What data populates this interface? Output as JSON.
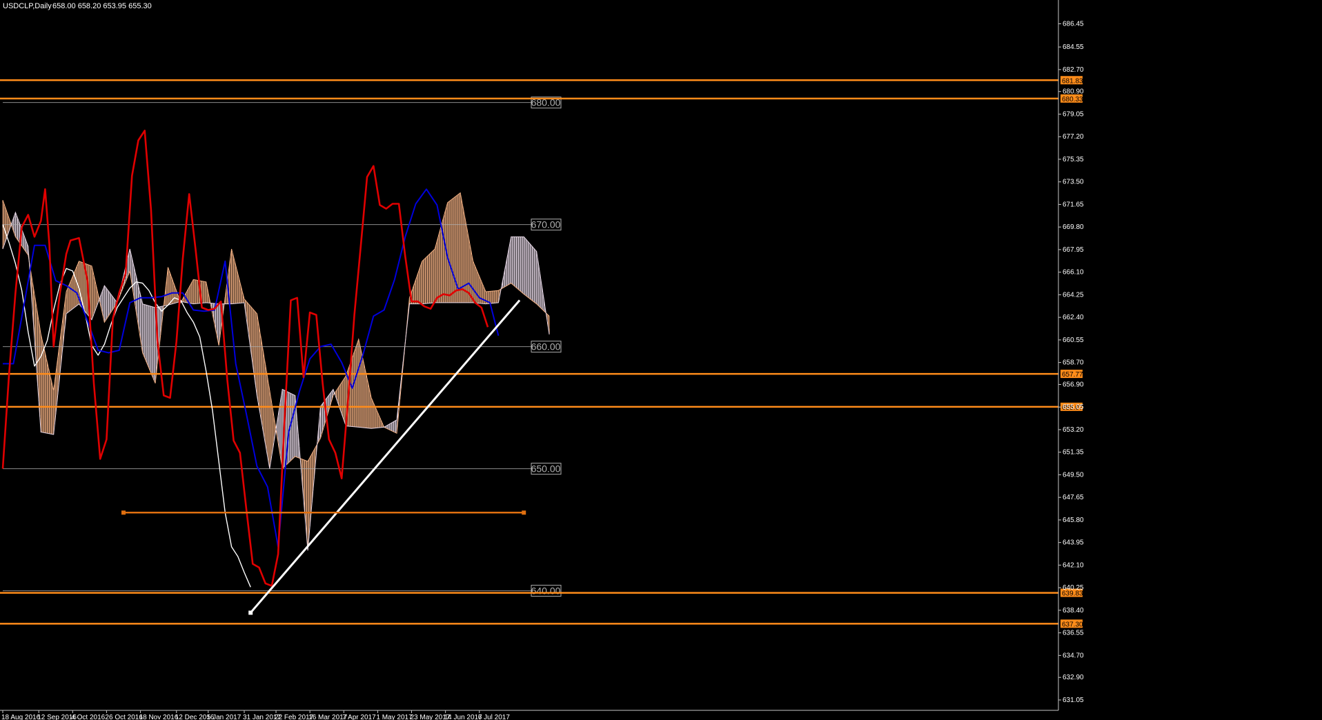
{
  "header": {
    "symbol": "USDCLP,Daily",
    "ohlc": "658.00 658.20 653.95 655.30"
  },
  "colors": {
    "background": "#000000",
    "axis": "#c8c8c8",
    "tenkan": "#e00000",
    "kijun": "#0000dd",
    "chikou": "#ffffff",
    "cloud_bull": "#f4b183",
    "cloud_bear": "#e6d7e6",
    "hline": "#ff8c1a",
    "hline_tag": "#ff8c1a",
    "level": "#b0b0b0",
    "trendline": "#ffffff",
    "segment": "#e07010"
  },
  "chart_data": {
    "type": "line",
    "title": "USDCLP,Daily",
    "ylim": [
      630.2,
      688.4
    ],
    "y_ticks": [
      "686.45",
      "684.55",
      "682.70",
      "680.90",
      "679.05",
      "677.20",
      "675.35",
      "673.50",
      "671.65",
      "669.80",
      "667.95",
      "666.10",
      "664.25",
      "662.40",
      "660.55",
      "658.70",
      "656.90",
      "655.05",
      "653.20",
      "651.35",
      "649.50",
      "647.65",
      "645.80",
      "643.95",
      "642.10",
      "640.25",
      "638.40",
      "636.55",
      "634.70",
      "632.90",
      "631.05"
    ],
    "x_ticks": [
      "18 Aug 2016",
      "12 Sep 2016",
      "4 Oct 2016",
      "26 Oct 2016",
      "18 Nov 2016",
      "12 Dec 2016",
      "5 Jan 2017",
      "31 Jan 2017",
      "22 Feb 2017",
      "16 Mar 2017",
      "7 Apr 2017",
      "1 May 2017",
      "23 May 2017",
      "14 Jun 2017",
      "6 Jul 2017"
    ],
    "x_tick_bars": [
      0,
      17,
      33,
      49,
      65,
      82,
      97,
      114,
      129,
      145,
      161,
      177,
      193,
      209,
      225
    ],
    "total_bars": 248,
    "horizontal_lines": [
      {
        "label": "681.83",
        "value": 681.83
      },
      {
        "label": "680.33",
        "value": 680.33
      },
      {
        "label": "657.77",
        "value": 657.77
      },
      {
        "label": "655.07",
        "value": 655.07
      },
      {
        "label": "639.83",
        "value": 639.83
      },
      {
        "label": "637.30",
        "value": 637.3
      }
    ],
    "levels": [
      {
        "label": "680.00",
        "value": 680.0
      },
      {
        "label": "670.00",
        "value": 670.0
      },
      {
        "label": "660.00",
        "value": 660.0
      },
      {
        "label": "650.00",
        "value": 650.0
      },
      {
        "label": "640.00",
        "value": 640.0
      }
    ],
    "trendline": {
      "from": [
        117,
        638.2
      ],
      "to": [
        244,
        663.8
      ]
    },
    "segment": {
      "from": [
        57,
        646.4
      ],
      "to": [
        246,
        646.4
      ]
    },
    "series": [
      {
        "role": "tenkan",
        "x": [
          0,
          3,
          6,
          9,
          12,
          15,
          18,
          20,
          22,
          24,
          27,
          30,
          32,
          36,
          40,
          43,
          46,
          49,
          52,
          55,
          58,
          61,
          64,
          67,
          70,
          73,
          76,
          79,
          82,
          85,
          88,
          91,
          94,
          97,
          100,
          103,
          106,
          109,
          112,
          115,
          118,
          121,
          124,
          127,
          130,
          133,
          136,
          139,
          142,
          145,
          148,
          151,
          154,
          157,
          160,
          163,
          166,
          169,
          172,
          175,
          178,
          181,
          184,
          187,
          190,
          193,
          196,
          199,
          202,
          205,
          208,
          211,
          214,
          217,
          220,
          223,
          226,
          229
        ],
        "y": [
          650.0,
          657.8,
          664.4,
          669.8,
          670.8,
          669.0,
          670.3,
          672.9,
          668.4,
          660.0,
          664.4,
          667.6,
          668.7,
          668.9,
          665.4,
          657.0,
          650.8,
          652.4,
          662.3,
          664.4,
          666.0,
          674.0,
          676.9,
          677.7,
          671.2,
          660.5,
          656.0,
          655.8,
          660.4,
          667.2,
          672.5,
          668.0,
          663.2,
          663.0,
          663.1,
          663.7,
          657.3,
          652.3,
          651.3,
          646.7,
          642.2,
          641.9,
          640.6,
          640.4,
          643.0,
          653.9,
          663.8,
          664.0,
          657.5,
          662.8,
          662.6,
          657.0,
          652.4,
          651.3,
          649.2,
          655.6,
          662.6,
          668.2,
          673.9,
          674.8,
          671.6,
          671.3,
          671.7,
          671.7,
          667.4,
          663.7,
          663.7,
          663.3,
          663.1,
          664.0,
          664.3,
          664.2,
          664.6,
          664.7,
          664.4,
          663.6,
          663.2,
          661.6
        ]
      },
      {
        "role": "kijun",
        "x": [
          0,
          5,
          10,
          15,
          20,
          25,
          30,
          35,
          40,
          45,
          50,
          55,
          60,
          65,
          70,
          75,
          80,
          85,
          90,
          95,
          100,
          105,
          110,
          115,
          120,
          125,
          130,
          135,
          140,
          145,
          150,
          155,
          160,
          165,
          170,
          175,
          180,
          185,
          190,
          195,
          200,
          205,
          210,
          215,
          220,
          225,
          230,
          234
        ],
        "y": [
          658.6,
          658.6,
          663.4,
          668.3,
          668.3,
          665.4,
          665.0,
          664.4,
          662.1,
          659.7,
          659.5,
          659.7,
          663.6,
          664.0,
          664.0,
          664.1,
          664.4,
          664.4,
          663.0,
          662.9,
          663.0,
          667.0,
          658.6,
          654.5,
          650.2,
          648.5,
          643.6,
          653.0,
          656.3,
          659.0,
          660.0,
          660.2,
          658.7,
          656.6,
          659.3,
          662.5,
          663.0,
          665.5,
          669.0,
          671.7,
          672.9,
          671.6,
          667.3,
          664.7,
          665.2,
          664.0,
          663.6,
          660.9
        ]
      },
      {
        "role": "chikou",
        "x": [
          0,
          3,
          6,
          9,
          12,
          15,
          18,
          21,
          24,
          27,
          30,
          33,
          36,
          39,
          42,
          45,
          48,
          51,
          54,
          57,
          60,
          63,
          66,
          69,
          72,
          75,
          78,
          81,
          84,
          87,
          90,
          93,
          96,
          99,
          102,
          105,
          108,
          111,
          114,
          117
        ],
        "y": [
          670.0,
          668.5,
          666.8,
          664.6,
          661.2,
          658.4,
          659.2,
          660.5,
          663.0,
          665.1,
          666.4,
          666.2,
          664.8,
          662.6,
          660.1,
          659.3,
          660.2,
          661.8,
          663.2,
          664.0,
          664.8,
          665.3,
          665.2,
          664.6,
          663.6,
          662.9,
          663.4,
          664.0,
          663.8,
          662.8,
          662.0,
          660.8,
          658.0,
          654.8,
          650.6,
          646.4,
          643.6,
          642.8,
          641.5,
          640.3
        ]
      },
      {
        "role": "senkou_a",
        "x": [
          0,
          6,
          12,
          18,
          24,
          30,
          36,
          42,
          48,
          54,
          60,
          66,
          72,
          78,
          84,
          90,
          96,
          102,
          108,
          114,
          120,
          126,
          132,
          138,
          144,
          150,
          156,
          162,
          168,
          174,
          180,
          186,
          192,
          198,
          204,
          210,
          216,
          222,
          228,
          234,
          240,
          246,
          252,
          258
        ],
        "y": [
          672.0,
          669.0,
          667.5,
          661.0,
          656.4,
          664.5,
          667.0,
          666.6,
          662.0,
          663.6,
          666.2,
          659.5,
          657.0,
          666.5,
          663.6,
          665.5,
          665.3,
          660.1,
          668.0,
          663.9,
          662.7,
          656.4,
          650.0,
          651.0,
          650.6,
          652.5,
          656.0,
          657.6,
          660.6,
          655.8,
          653.4,
          652.9,
          664.0,
          667.0,
          668.0,
          671.8,
          672.6,
          667.0,
          664.5,
          664.6,
          665.2,
          664.3,
          663.5,
          662.5
        ]
      },
      {
        "role": "senkou_b",
        "x": [
          0,
          6,
          12,
          18,
          24,
          30,
          36,
          42,
          48,
          54,
          60,
          66,
          72,
          78,
          84,
          90,
          96,
          102,
          108,
          114,
          120,
          126,
          132,
          138,
          144,
          150,
          156,
          162,
          168,
          174,
          180,
          186,
          192,
          198,
          204,
          210,
          216,
          222,
          228,
          234,
          240,
          246,
          252,
          258
        ],
        "y": [
          668.0,
          671.0,
          668.2,
          653.0,
          652.8,
          662.7,
          663.5,
          662.2,
          665.0,
          663.6,
          668.0,
          663.5,
          663.2,
          663.4,
          663.7,
          663.5,
          663.6,
          663.5,
          663.5,
          663.6,
          656.0,
          650.0,
          656.5,
          656.0,
          643.3,
          655.1,
          656.5,
          653.5,
          653.4,
          653.3,
          653.4,
          654.0,
          663.5,
          663.5,
          663.6,
          663.6,
          663.6,
          663.6,
          663.5,
          663.6,
          669.0,
          669.0,
          667.8,
          661.0
        ]
      }
    ]
  }
}
